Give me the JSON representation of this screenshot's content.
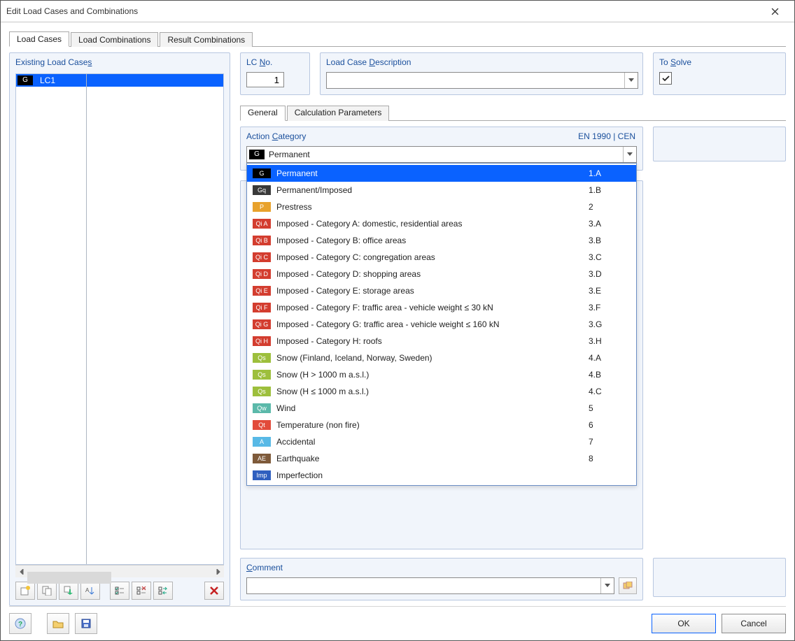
{
  "window": {
    "title": "Edit Load Cases and Combinations"
  },
  "top_tabs": {
    "load_cases": "Load Cases",
    "load_combinations": "Load Combinations",
    "result_combinations": "Result Combinations"
  },
  "existing": {
    "title_pre": "Existing Load Case",
    "title_ul": "s",
    "items": [
      {
        "tag": "G",
        "name": "LC1"
      }
    ]
  },
  "lcno": {
    "title_pre": "LC ",
    "title_ul": "N",
    "title_post": "o.",
    "value": "1"
  },
  "lcdesc": {
    "title_pre": "Load Case ",
    "title_ul": "D",
    "title_post": "escription",
    "value": ""
  },
  "tosolve": {
    "title_pre": "To ",
    "title_ul": "S",
    "title_post": "olve",
    "checked": true
  },
  "inner_tabs": {
    "general": "General",
    "calc": "Calculation Parameters"
  },
  "action": {
    "title_pre": "Action ",
    "title_ul": "C",
    "title_post": "ategory",
    "right": "EN 1990 | CEN",
    "selected": {
      "tag": "G",
      "label": "Permanent"
    },
    "options": [
      {
        "tag": "G",
        "tag_class": "bg-black",
        "label": "Permanent",
        "code": "1.A",
        "selected": true
      },
      {
        "tag": "Gq",
        "tag_class": "bg-grey",
        "label": "Permanent/Imposed",
        "code": "1.B"
      },
      {
        "tag": "P",
        "tag_class": "bg-orange",
        "label": "Prestress",
        "code": "2"
      },
      {
        "tag": "Qi A",
        "tag_class": "bg-red",
        "label": "Imposed - Category A: domestic, residential areas",
        "code": "3.A"
      },
      {
        "tag": "Qi B",
        "tag_class": "bg-red",
        "label": "Imposed - Category B: office areas",
        "code": "3.B"
      },
      {
        "tag": "Qi C",
        "tag_class": "bg-red",
        "label": "Imposed - Category C: congregation areas",
        "code": "3.C"
      },
      {
        "tag": "Qi D",
        "tag_class": "bg-red",
        "label": "Imposed - Category D: shopping areas",
        "code": "3.D"
      },
      {
        "tag": "Qi E",
        "tag_class": "bg-red",
        "label": "Imposed - Category E: storage areas",
        "code": "3.E"
      },
      {
        "tag": "Qi F",
        "tag_class": "bg-red",
        "label": "Imposed - Category F: traffic area - vehicle weight ≤ 30 kN",
        "code": "3.F"
      },
      {
        "tag": "Qi G",
        "tag_class": "bg-red",
        "label": "Imposed - Category G: traffic area - vehicle weight ≤ 160 kN",
        "code": "3.G"
      },
      {
        "tag": "Qi H",
        "tag_class": "bg-red",
        "label": "Imposed - Category H: roofs",
        "code": "3.H"
      },
      {
        "tag": "Qs",
        "tag_class": "bg-ygreen",
        "label": "Snow (Finland, Iceland, Norway, Sweden)",
        "code": "4.A"
      },
      {
        "tag": "Qs",
        "tag_class": "bg-ygreen",
        "label": "Snow (H > 1000 m a.s.l.)",
        "code": "4.B"
      },
      {
        "tag": "Qs",
        "tag_class": "bg-ygreen",
        "label": "Snow (H ≤ 1000 m a.s.l.)",
        "code": "4.C"
      },
      {
        "tag": "Qw",
        "tag_class": "bg-teal",
        "label": "Wind",
        "code": "5"
      },
      {
        "tag": "Qt",
        "tag_class": "bg-red2",
        "label": "Temperature (non fire)",
        "code": "6"
      },
      {
        "tag": "A",
        "tag_class": "bg-cyan",
        "label": "Accidental",
        "code": "7"
      },
      {
        "tag": "AE",
        "tag_class": "bg-brown",
        "label": "Earthquake",
        "code": "8"
      },
      {
        "tag": "Imp",
        "tag_class": "bg-blue",
        "label": "Imperfection",
        "code": ""
      }
    ]
  },
  "comment": {
    "title_ul": "C",
    "title_post": "omment",
    "value": ""
  },
  "footer": {
    "ok": "OK",
    "cancel": "Cancel"
  }
}
